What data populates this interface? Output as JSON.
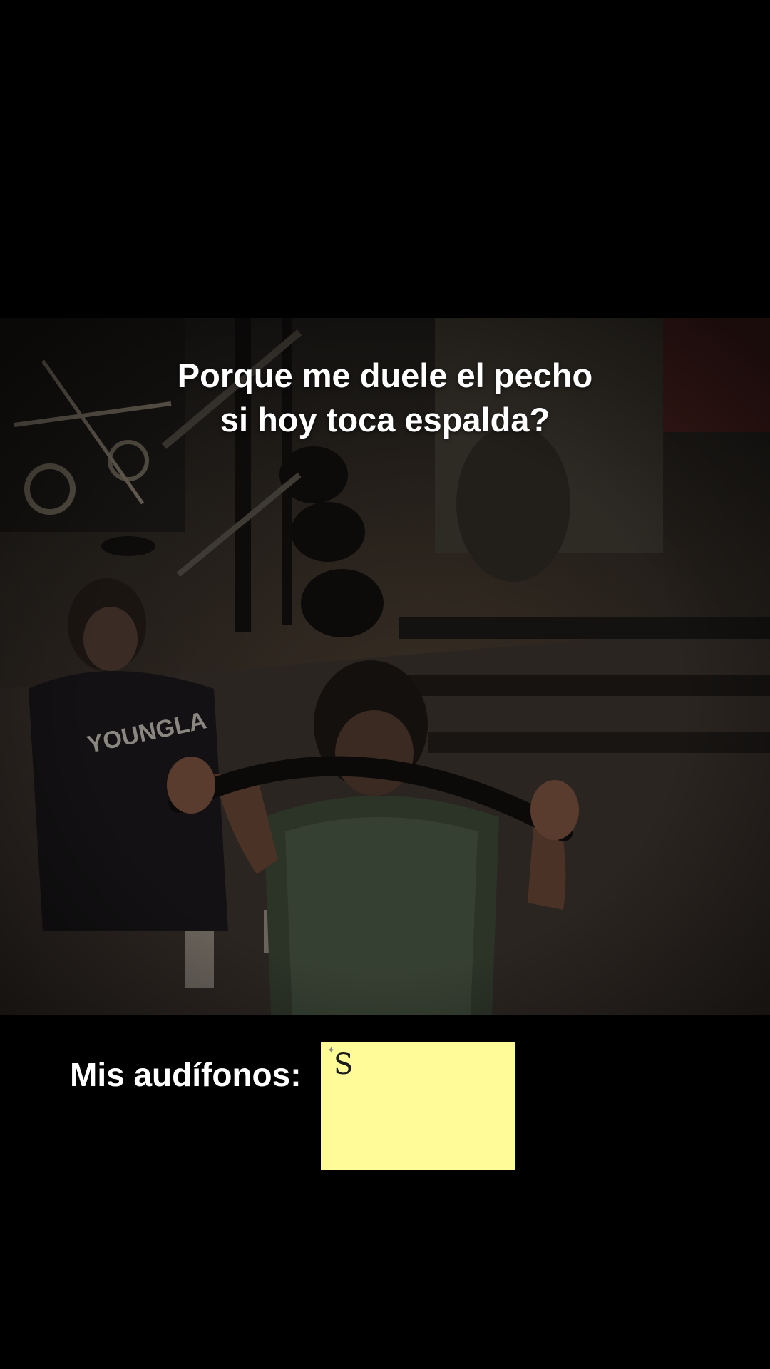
{
  "caption": {
    "line1": "Porque me duele el pecho",
    "line2": "si hoy toca espalda?"
  },
  "meme": {
    "label": "Mis audífonos:",
    "note_text": "S",
    "note_color": "#fffb99"
  },
  "colors": {
    "background": "#000000",
    "text": "#ffffff"
  },
  "video_content": "dim gym scene: man in green mesh jersey doing cable pulldown with a rope bar, woman in dark YOUNGLA hoodie behind him, gym machines in background",
  "shirt_text": "YOUNGLA"
}
